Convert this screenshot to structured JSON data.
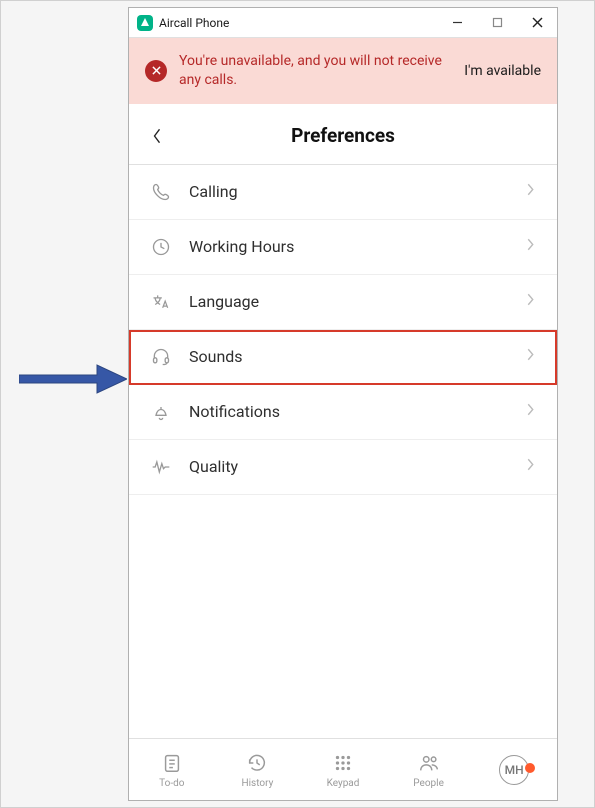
{
  "window": {
    "title": "Aircall Phone"
  },
  "banner": {
    "message": "You're unavailable, and you will not receive any calls.",
    "action": "I'm available"
  },
  "header": {
    "title": "Preferences"
  },
  "menu": [
    {
      "label": "Calling"
    },
    {
      "label": "Working Hours"
    },
    {
      "label": "Language"
    },
    {
      "label": "Sounds"
    },
    {
      "label": "Notifications"
    },
    {
      "label": "Quality"
    }
  ],
  "bottomNav": {
    "items": [
      {
        "label": "To-do"
      },
      {
        "label": "History"
      },
      {
        "label": "Keypad"
      },
      {
        "label": "People"
      }
    ],
    "avatar": "MH"
  }
}
